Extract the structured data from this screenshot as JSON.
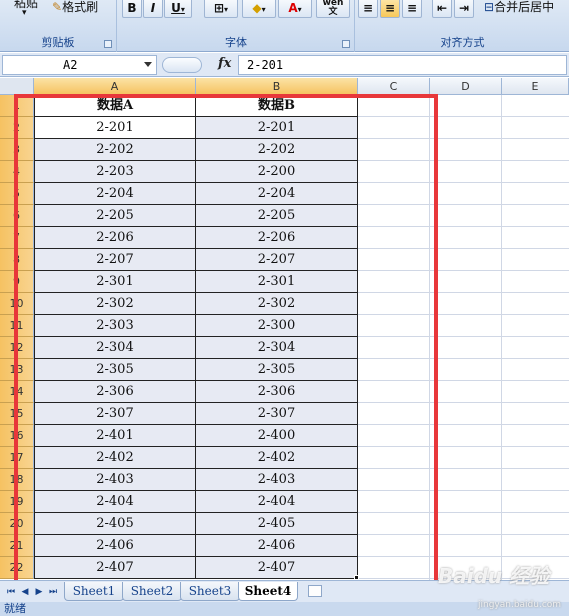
{
  "ribbon": {
    "paste_label": "粘贴",
    "format_painter_label": "格式刷",
    "bold_label": "B",
    "italic_label": "I",
    "underline_label": "U",
    "phonetic_label": "wén 文",
    "merge_label": "合并后居中",
    "groups": {
      "clipboard": "剪贴板",
      "font": "字体",
      "alignment": "对齐方式"
    }
  },
  "formula_bar": {
    "name_box": "A2",
    "fx": "fx",
    "value": "2-201"
  },
  "columns": [
    "A",
    "B",
    "C",
    "D",
    "E"
  ],
  "rows": [
    "1",
    "2",
    "3",
    "4",
    "5",
    "6",
    "7",
    "8",
    "9",
    "10",
    "11",
    "12",
    "13",
    "14",
    "15",
    "16",
    "17",
    "18",
    "19",
    "20",
    "21",
    "22"
  ],
  "table": {
    "headers": [
      "数据A",
      "数据B"
    ],
    "data": [
      [
        "2-201",
        "2-201"
      ],
      [
        "2-202",
        "2-202"
      ],
      [
        "2-203",
        "2-200"
      ],
      [
        "2-204",
        "2-204"
      ],
      [
        "2-205",
        "2-205"
      ],
      [
        "2-206",
        "2-206"
      ],
      [
        "2-207",
        "2-207"
      ],
      [
        "2-301",
        "2-301"
      ],
      [
        "2-302",
        "2-302"
      ],
      [
        "2-303",
        "2-300"
      ],
      [
        "2-304",
        "2-304"
      ],
      [
        "2-305",
        "2-305"
      ],
      [
        "2-306",
        "2-306"
      ],
      [
        "2-307",
        "2-307"
      ],
      [
        "2-401",
        "2-400"
      ],
      [
        "2-402",
        "2-402"
      ],
      [
        "2-403",
        "2-403"
      ],
      [
        "2-404",
        "2-404"
      ],
      [
        "2-405",
        "2-405"
      ],
      [
        "2-406",
        "2-406"
      ],
      [
        "2-407",
        "2-407"
      ]
    ]
  },
  "sheets": [
    "Sheet1",
    "Sheet2",
    "Sheet3",
    "Sheet4"
  ],
  "active_sheet": "Sheet4",
  "status_text": "就绪",
  "watermark": "Baidu 经验",
  "watermark_sub": "jingyan.baidu.com",
  "colors": {
    "highlight": "#e8373a",
    "row_header": "#f6c262",
    "ribbon_label": "#15428b"
  }
}
